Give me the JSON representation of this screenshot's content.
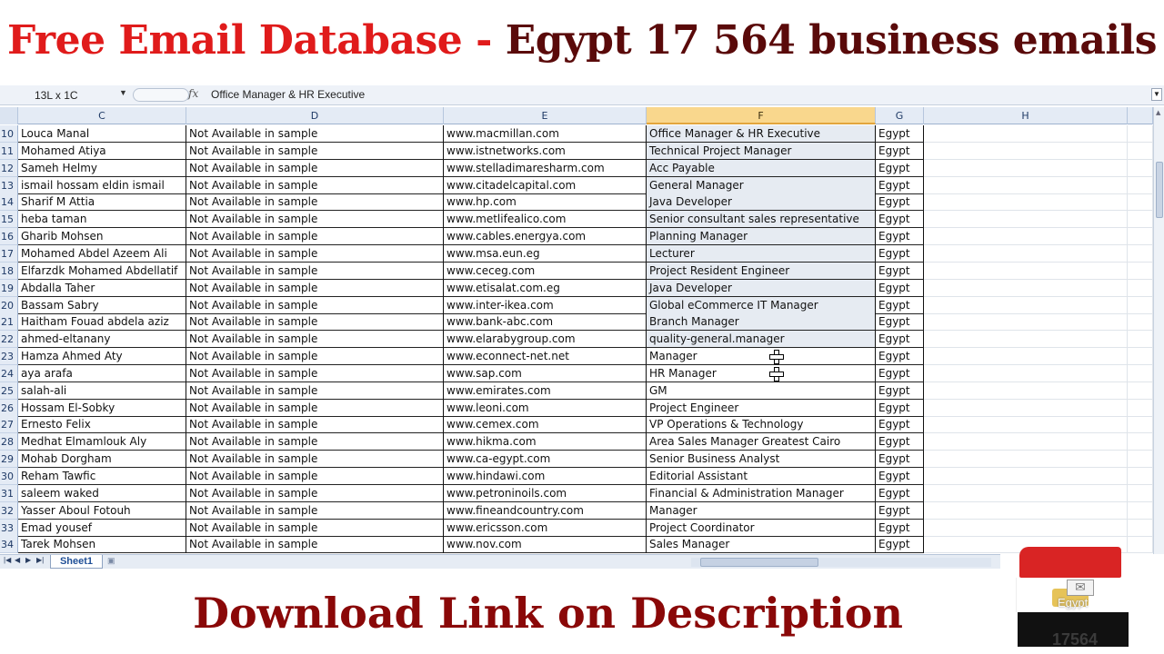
{
  "banner": {
    "title_red": "Free Email Database - ",
    "title_dark": "Egypt 17 564 business emails"
  },
  "formula_bar": {
    "name_box": "13L x 1C",
    "fx_label": "fx",
    "content": "Office Manager & HR Executive"
  },
  "columns": [
    "C",
    "D",
    "E",
    "F",
    "G",
    "H"
  ],
  "selected_column": "F",
  "rows": [
    {
      "n": "10",
      "name": "Louca Manal",
      "email": "Not Available in sample",
      "website": "www.macmillan.com",
      "title": "Office Manager & HR Executive",
      "country": "Egypt"
    },
    {
      "n": "11",
      "name": "Mohamed Atiya",
      "email": "Not Available in sample",
      "website": "www.istnetworks.com",
      "title": "Technical Project Manager",
      "country": "Egypt"
    },
    {
      "n": "12",
      "name": "Sameh Helmy",
      "email": "Not Available in sample",
      "website": "www.stelladimaresharm.com",
      "title": "Acc Payable",
      "country": "Egypt"
    },
    {
      "n": "13",
      "name": "ismail hossam eldin ismail",
      "email": "Not Available in sample",
      "website": "www.citadelcapital.com",
      "title": "General Manager",
      "country": "Egypt"
    },
    {
      "n": "14",
      "name": "Sharif M  Attia",
      "email": "Not Available in sample",
      "website": "www.hp.com",
      "title": "Java Developer",
      "country": "Egypt"
    },
    {
      "n": "15",
      "name": "heba taman",
      "email": "Not Available in sample",
      "website": "www.metlifealico.com",
      "title": "Senior consultant sales representative",
      "country": "Egypt"
    },
    {
      "n": "16",
      "name": "Gharib Mohsen",
      "email": "Not Available in sample",
      "website": "www.cables.energya.com",
      "title": "Planning Manager",
      "country": "Egypt"
    },
    {
      "n": "17",
      "name": "Mohamed Abdel Azeem Ali",
      "email": "Not Available in sample",
      "website": "www.msa.eun.eg",
      "title": "Lecturer",
      "country": "Egypt"
    },
    {
      "n": "18",
      "name": "Elfarzdk Mohamed Abdellatif",
      "email": "Not Available in sample",
      "website": "www.ceceg.com",
      "title": "Project Resident Engineer",
      "country": "Egypt"
    },
    {
      "n": "19",
      "name": "Abdalla Taher",
      "email": "Not Available in sample",
      "website": "www.etisalat.com.eg",
      "title": "Java Developer",
      "country": "Egypt"
    },
    {
      "n": "20",
      "name": "Bassam Sabry",
      "email": "Not Available in sample",
      "website": "www.inter-ikea.com",
      "title": "Global eCommerce IT Manager",
      "country": "Egypt"
    },
    {
      "n": "21",
      "name": "Haitham Fouad abdela aziz",
      "email": "Not Available in sample",
      "website": "www.bank-abc.com",
      "title": "Branch Manager",
      "country": "Egypt"
    },
    {
      "n": "22",
      "name": "ahmed-eltanany",
      "email": "Not Available in sample",
      "website": "www.elarabygroup.com",
      "title": "quality-general.manager",
      "country": "Egypt"
    },
    {
      "n": "23",
      "name": "Hamza Ahmed Aty",
      "email": "Not Available in sample",
      "website": "www.econnect-net.net",
      "title": "Manager",
      "country": "Egypt"
    },
    {
      "n": "24",
      "name": "aya arafa",
      "email": "Not Available in sample",
      "website": "www.sap.com",
      "title": "HR Manager",
      "country": "Egypt"
    },
    {
      "n": "25",
      "name": "salah-ali",
      "email": "Not Available in sample",
      "website": "www.emirates.com",
      "title": "GM",
      "country": "Egypt"
    },
    {
      "n": "26",
      "name": "Hossam El-Sobky",
      "email": "Not Available in sample",
      "website": "www.leoni.com",
      "title": "Project Engineer",
      "country": "Egypt"
    },
    {
      "n": "27",
      "name": "Ernesto Felix",
      "email": "Not Available in sample",
      "website": "www.cemex.com",
      "title": "VP Operations & Technology",
      "country": "Egypt"
    },
    {
      "n": "28",
      "name": "Medhat Elmamlouk Aly",
      "email": "Not Available in sample",
      "website": "www.hikma.com",
      "title": "Area Sales Manager Greatest Cairo",
      "country": "Egypt"
    },
    {
      "n": "29",
      "name": "Mohab Dorgham",
      "email": "Not Available in sample",
      "website": "www.ca-egypt.com",
      "title": "Senior Business Analyst",
      "country": "Egypt"
    },
    {
      "n": "30",
      "name": "Reham Tawfic",
      "email": "Not Available in sample",
      "website": "www.hindawi.com",
      "title": "Editorial Assistant",
      "country": "Egypt"
    },
    {
      "n": "31",
      "name": "saleem waked",
      "email": "Not Available in sample",
      "website": "www.petroninoils.com",
      "title": "Financial & Administration Manager",
      "country": "Egypt"
    },
    {
      "n": "32",
      "name": "Yasser Aboul Fotouh",
      "email": "Not Available in sample",
      "website": "www.fineandcountry.com",
      "title": "Manager",
      "country": "Egypt"
    },
    {
      "n": "33",
      "name": "Emad yousef",
      "email": "Not Available in sample",
      "website": "www.ericsson.com",
      "title": "Project Coordinator",
      "country": "Egypt"
    },
    {
      "n": "34",
      "name": "Tarek Mohsen",
      "email": "Not Available in sample",
      "website": "www.nov.com",
      "title": "Sales Manager",
      "country": "Egypt"
    }
  ],
  "sheet_tab": "Sheet1",
  "bottom_banner": "Download Link on Description",
  "flag": {
    "label": "Egypt",
    "count": "17564"
  },
  "colors": {
    "title_red": "#e01b1b",
    "title_dark": "#5a0a0a",
    "bottom_banner": "#8a0808",
    "selected_header": "#f9d78d",
    "selected_cells": "#e6ebf2"
  }
}
